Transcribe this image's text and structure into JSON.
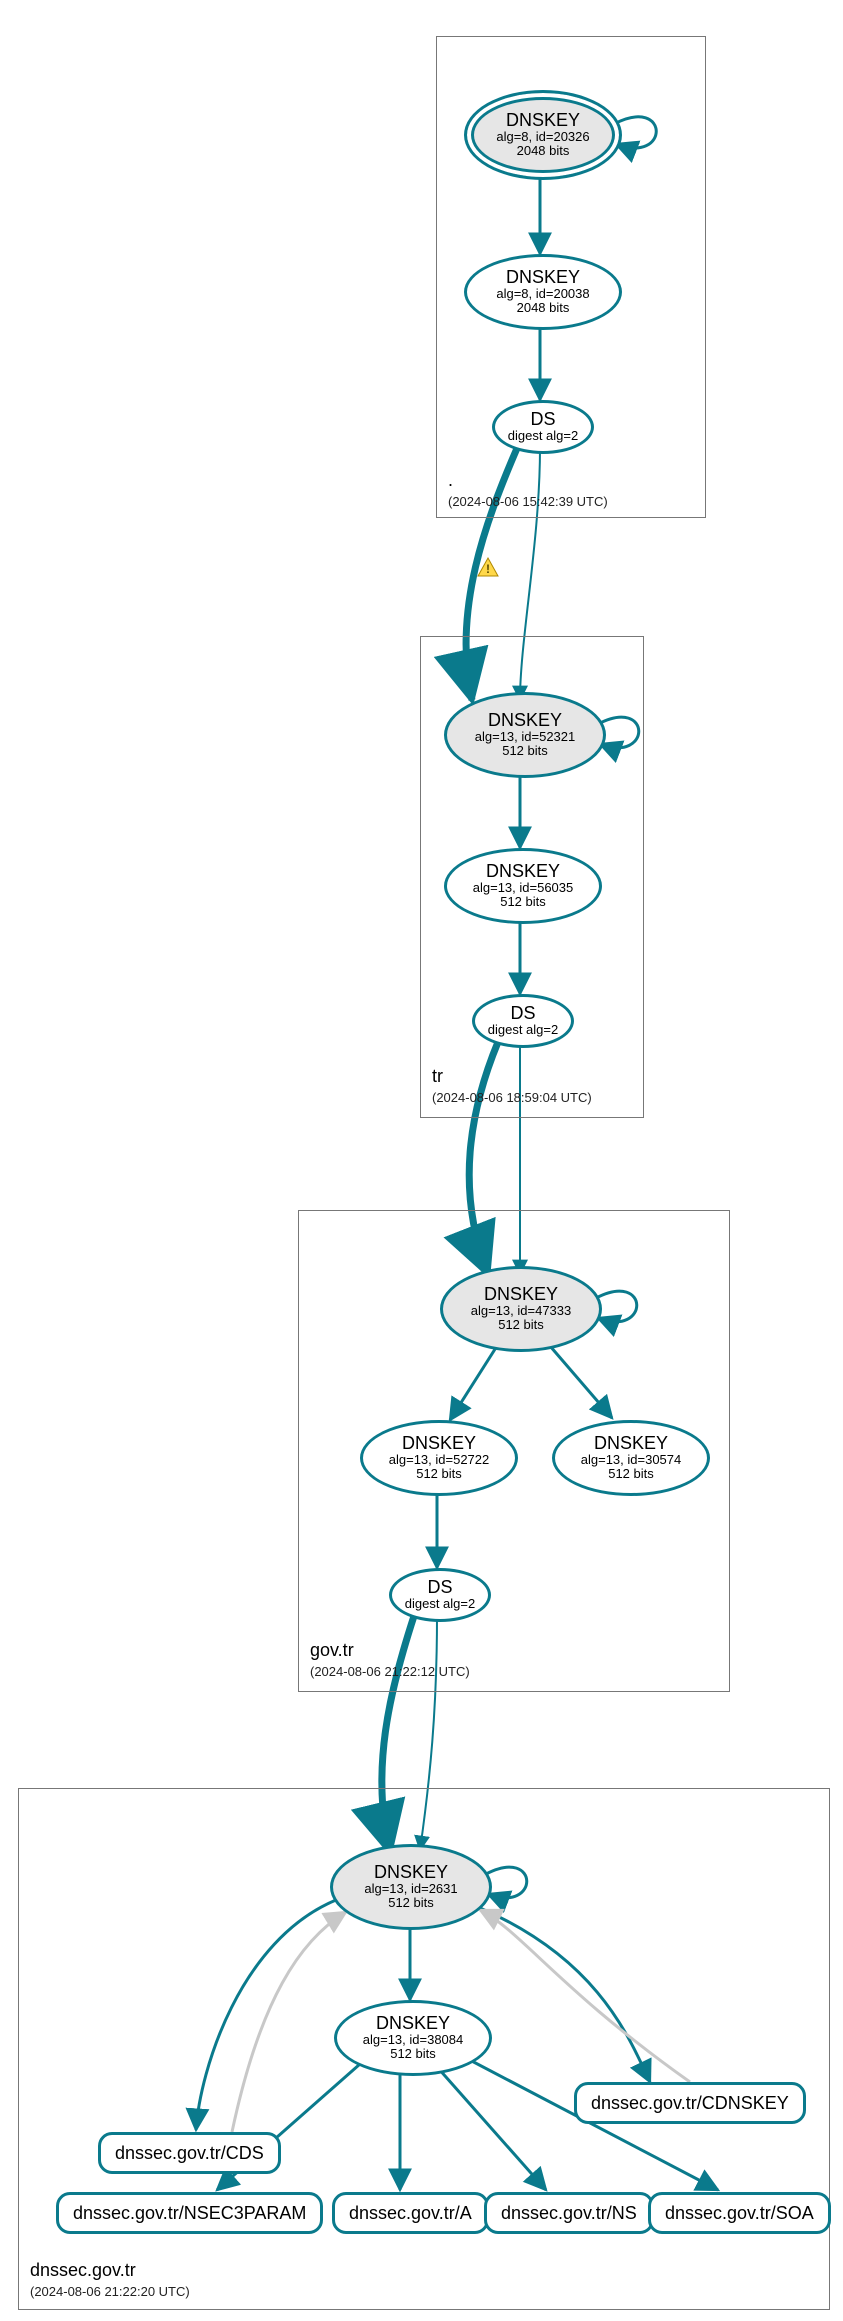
{
  "zones": {
    "root": {
      "label": ".",
      "sublabel": "(2024-08-06 15:42:39 UTC)"
    },
    "tr": {
      "label": "tr",
      "sublabel": "(2024-08-06 18:59:04 UTC)"
    },
    "govtr": {
      "label": "gov.tr",
      "sublabel": "(2024-08-06 21:22:12 UTC)"
    },
    "dnssec": {
      "label": "dnssec.gov.tr",
      "sublabel": "(2024-08-06 21:22:20 UTC)"
    }
  },
  "root": {
    "ksk": {
      "title": "DNSKEY",
      "sub1": "alg=8, id=20326",
      "sub2": "2048 bits"
    },
    "zsk": {
      "title": "DNSKEY",
      "sub1": "alg=8, id=20038",
      "sub2": "2048 bits"
    },
    "ds": {
      "title": "DS",
      "sub1": "digest alg=2"
    }
  },
  "tr": {
    "ksk": {
      "title": "DNSKEY",
      "sub1": "alg=13, id=52321",
      "sub2": "512 bits"
    },
    "zsk": {
      "title": "DNSKEY",
      "sub1": "alg=13, id=56035",
      "sub2": "512 bits"
    },
    "ds": {
      "title": "DS",
      "sub1": "digest alg=2"
    }
  },
  "govtr": {
    "ksk": {
      "title": "DNSKEY",
      "sub1": "alg=13, id=47333",
      "sub2": "512 bits"
    },
    "zsk": {
      "title": "DNSKEY",
      "sub1": "alg=13, id=52722",
      "sub2": "512 bits"
    },
    "zsk2": {
      "title": "DNSKEY",
      "sub1": "alg=13, id=30574",
      "sub2": "512 bits"
    },
    "ds": {
      "title": "DS",
      "sub1": "digest alg=2"
    }
  },
  "dnssec": {
    "ksk": {
      "title": "DNSKEY",
      "sub1": "alg=13, id=2631",
      "sub2": "512 bits"
    },
    "zsk": {
      "title": "DNSKEY",
      "sub1": "alg=13, id=38084",
      "sub2": "512 bits"
    }
  },
  "rr": {
    "cds": "dnssec.gov.tr/CDS",
    "cdnskey": "dnssec.gov.tr/CDNSKEY",
    "nsec3": "dnssec.gov.tr/NSEC3PARAM",
    "a": "dnssec.gov.tr/A",
    "ns": "dnssec.gov.tr/NS",
    "soa": "dnssec.gov.tr/SOA"
  }
}
